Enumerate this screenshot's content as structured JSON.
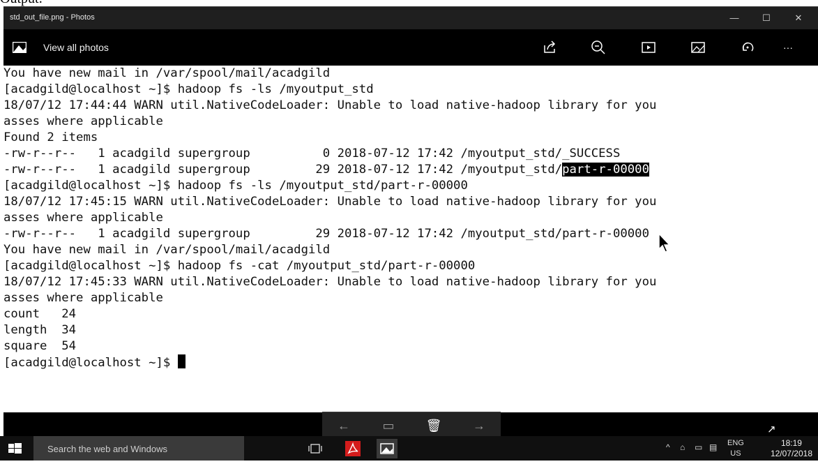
{
  "document": {
    "top_text": "Output:"
  },
  "window": {
    "title": "std_out_file.png - Photos",
    "controls": {
      "minimize": "—",
      "maximize": "☐",
      "close": "✕"
    }
  },
  "toolbar": {
    "view_all_label": "View all photos",
    "more_label": "···",
    "icons": [
      "share-icon",
      "zoom-out-icon",
      "slideshow-icon",
      "edit-icon",
      "rotate-icon",
      "more-icon"
    ]
  },
  "terminal": {
    "lines": [
      "You have new mail in /var/spool/mail/acadgild",
      "[acadgild@localhost ~]$ hadoop fs -ls /myoutput_std",
      "18/07/12 17:44:44 WARN util.NativeCodeLoader: Unable to load native-hadoop library for you",
      "asses where applicable",
      "Found 2 items",
      "-rw-r--r--   1 acadgild supergroup          0 2018-07-12 17:42 /myoutput_std/_SUCCESS",
      "-rw-r--r--   1 acadgild supergroup         29 2018-07-12 17:42 /myoutput_std/",
      "[acadgild@localhost ~]$ hadoop fs -ls /myoutput_std/part-r-00000",
      "18/07/12 17:45:15 WARN util.NativeCodeLoader: Unable to load native-hadoop library for you",
      "asses where applicable",
      "-rw-r--r--   1 acadgild supergroup         29 2018-07-12 17:42 /myoutput_std/part-r-00000",
      "You have new mail in /var/spool/mail/acadgild",
      "[acadgild@localhost ~]$ hadoop fs -cat /myoutput_std/part-r-00000",
      "18/07/12 17:45:33 WARN util.NativeCodeLoader: Unable to load native-hadoop library for you",
      "asses where applicable",
      "count   24",
      "length  34",
      "square  54",
      "[acadgild@localhost ~]$ "
    ],
    "highlighted_text": "part-r-00000"
  },
  "taskbar": {
    "search_placeholder": "Search the web and Windows",
    "language": "ENG",
    "region": "US",
    "time": "18:19",
    "date": "12/07/2018"
  },
  "colors": {
    "titlebar_bg": "#1f1f1f",
    "toolbar_bg": "#000000",
    "terminal_bg": "#ffffff",
    "taskbar_bg": "#101010",
    "search_bg": "#3a3a3a"
  }
}
